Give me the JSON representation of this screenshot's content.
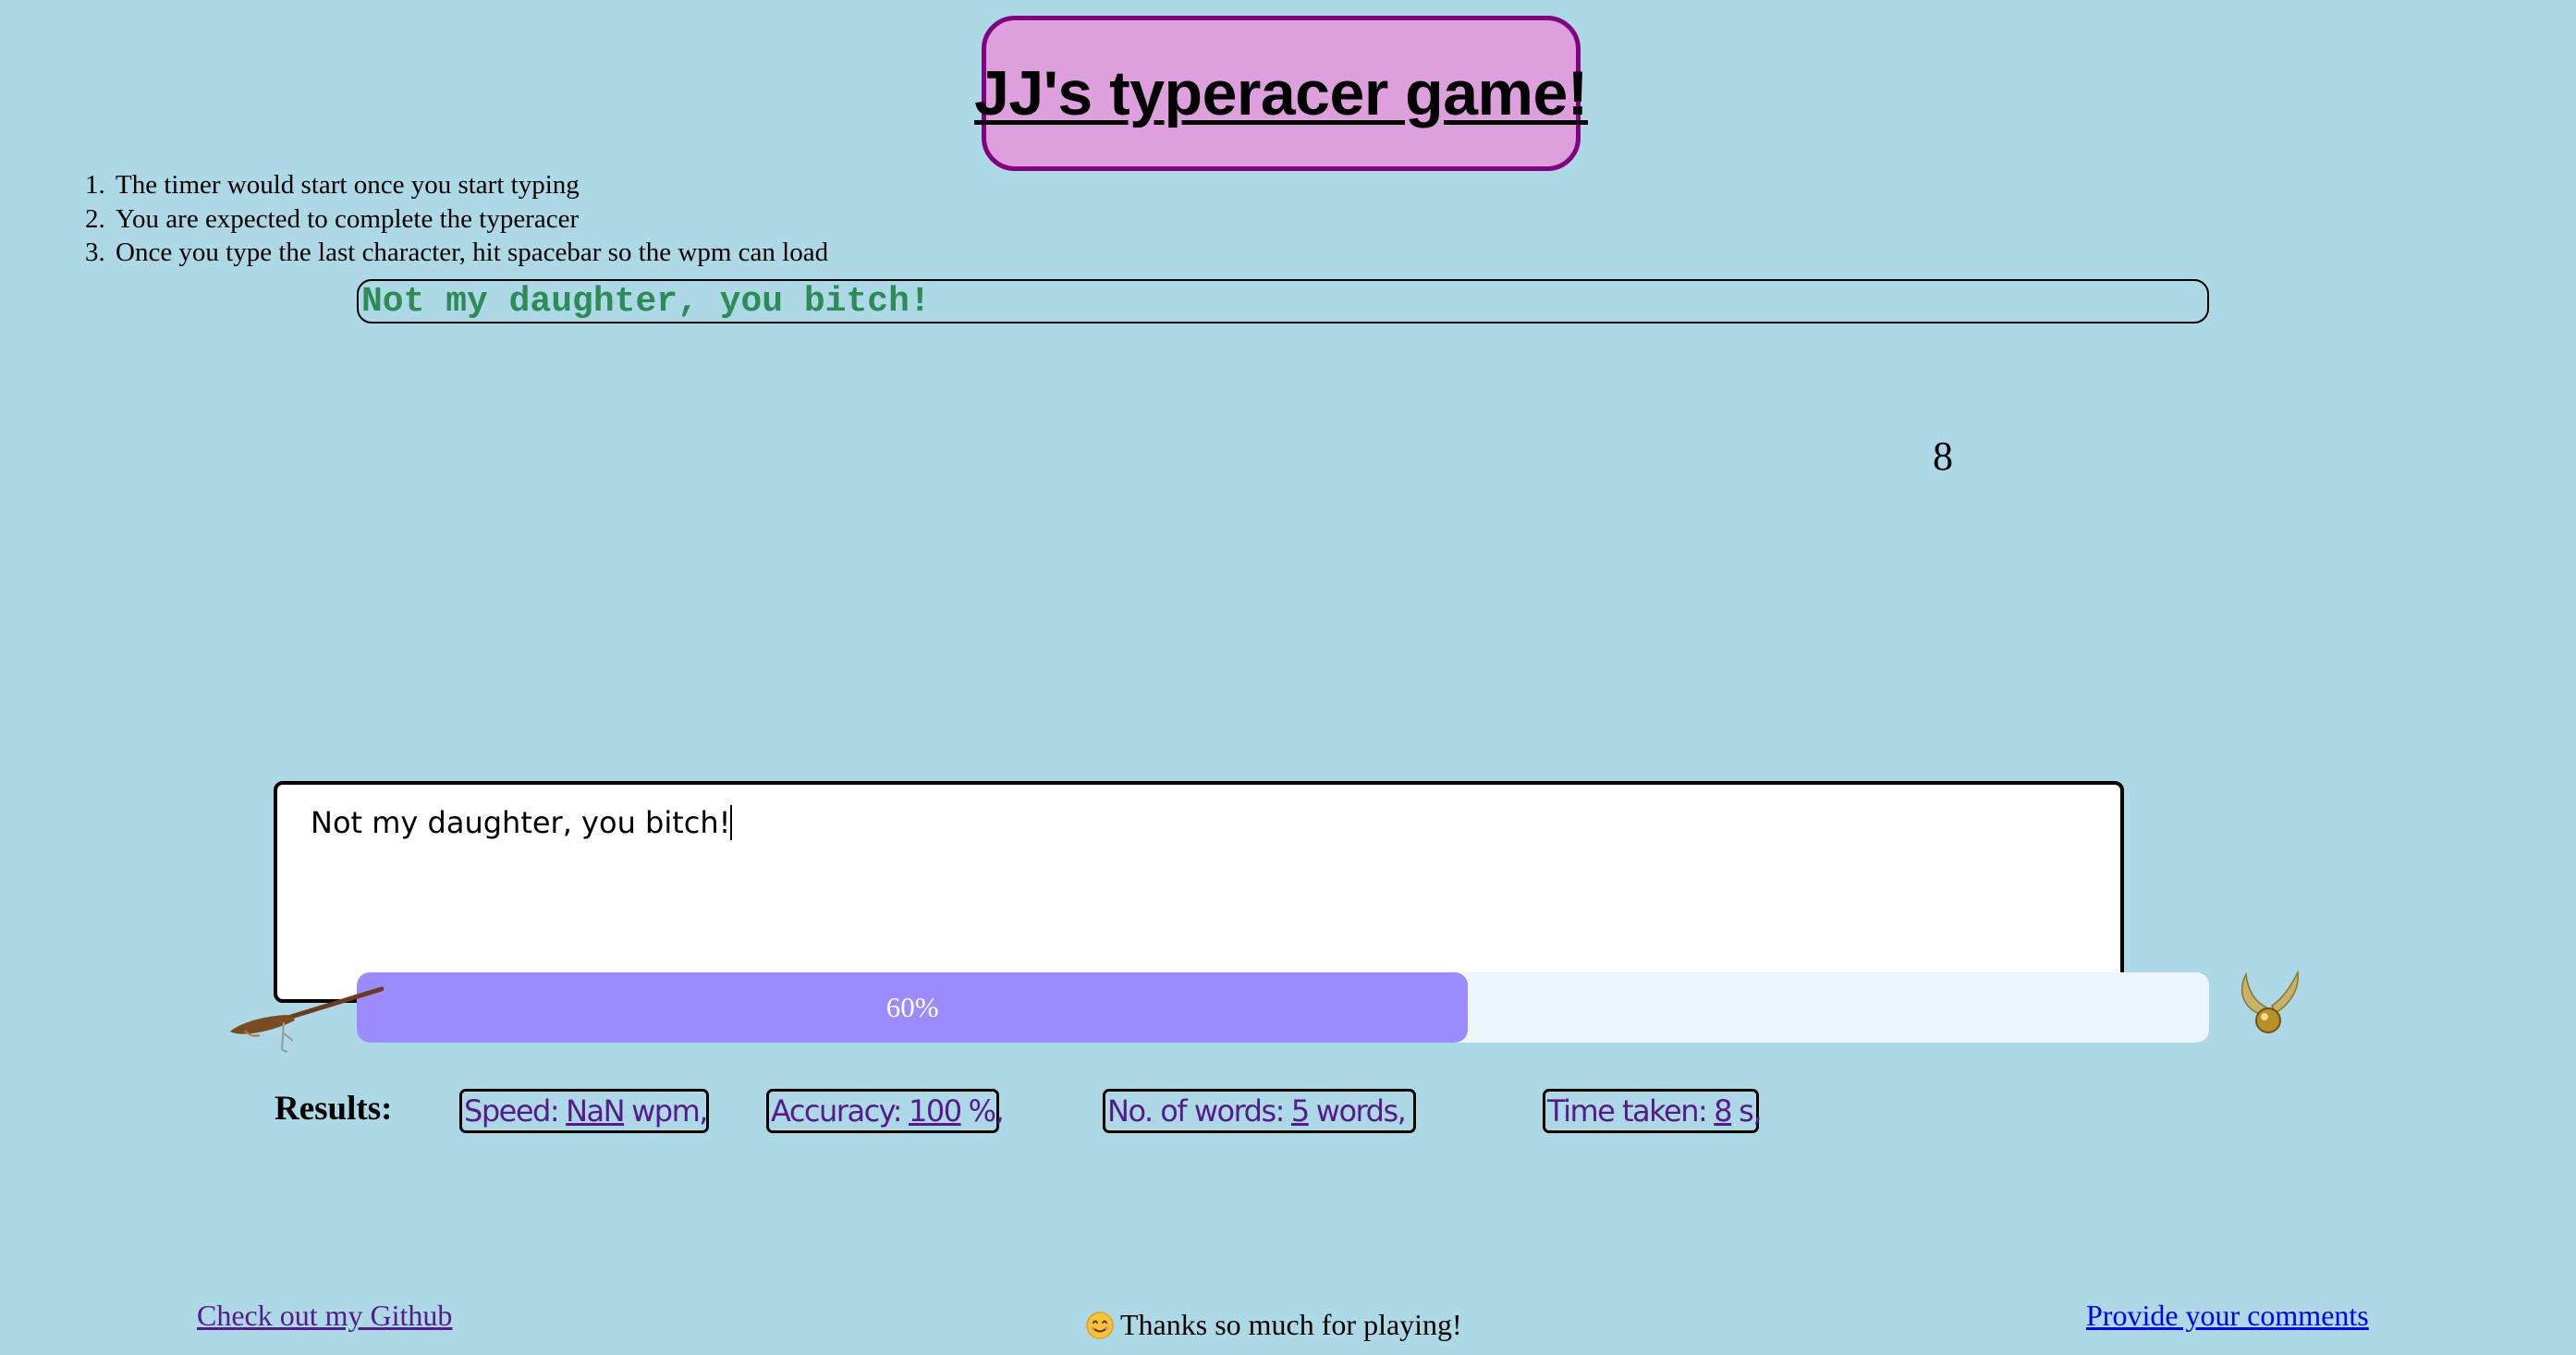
{
  "header": {
    "title": "JJ's typeracer game!"
  },
  "instructions": [
    {
      "num": "1.",
      "text": "The timer would start once you start typing"
    },
    {
      "num": "2.",
      "text": "You are expected to complete the typeracer"
    },
    {
      "num": "3.",
      "text": "Once you type the last character, hit spacebar so the wpm can load"
    }
  ],
  "quote": {
    "text": "Not my daughter, you bitch!",
    "color": "#2e8b57"
  },
  "timer": {
    "value": "8"
  },
  "typing_area": {
    "value": "Not my daughter, you bitch!"
  },
  "progress": {
    "label": "60%",
    "fraction": 0.6,
    "fill_color": "#9b8bff",
    "track_color": "#eef6fd"
  },
  "icons": {
    "left": "broomstick-icon",
    "right": "golden-snitch-icon"
  },
  "results": {
    "label": "Results:",
    "speed": {
      "prefix": "Speed:",
      "value": "NaN",
      "unit": "wpm,"
    },
    "accuracy": {
      "prefix": "Accuracy:",
      "value": "100",
      "unit": "%,"
    },
    "words": {
      "prefix": "No. of words:",
      "value": "5",
      "unit": "words,"
    },
    "time": {
      "prefix": "Time taken:",
      "value": "8",
      "unit": "s,"
    }
  },
  "footer": {
    "github_link": "Check out my Github",
    "thanks": "Thanks so much for playing!",
    "comments_link": "Provide your comments",
    "visited_link_color": "#551a8b",
    "link_color": "#0000ee"
  },
  "colors": {
    "background": "#add8e6",
    "title_bg": "#dda0dd",
    "title_border": "#800080"
  }
}
